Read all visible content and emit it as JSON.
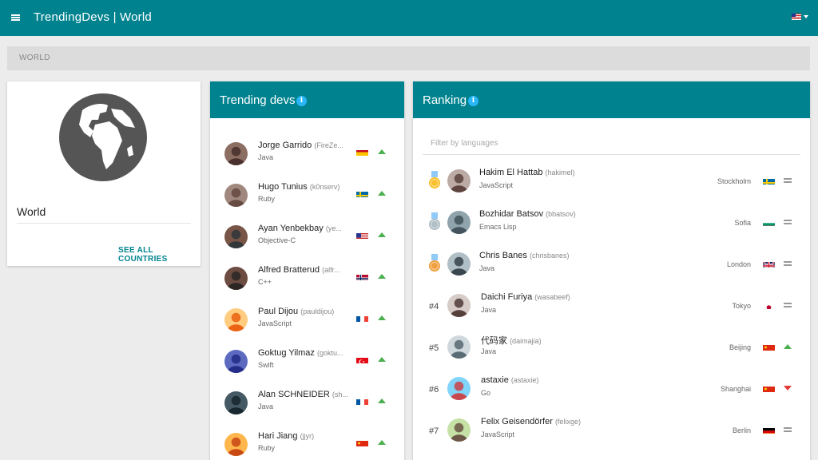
{
  "app": {
    "title": "TrendingDevs | World",
    "menu_icon": "hamburger-menu-icon",
    "language_flag": "us"
  },
  "breadcrumb": {
    "label": "WORLD"
  },
  "world_card": {
    "name": "World",
    "see_all_label": "SEE ALL COUNTRIES",
    "icon": "globe-icon"
  },
  "trending": {
    "title": "Trending devs",
    "items": [
      {
        "name": "Jorge Garrido",
        "handle": "(FireZe...",
        "language": "Java",
        "flag": "es",
        "trend": "up"
      },
      {
        "name": "Hugo Tunius",
        "handle": "(k0nserv)",
        "language": "Ruby",
        "flag": "se",
        "trend": "up"
      },
      {
        "name": "Ayan Yenbekbay",
        "handle": "(ye...",
        "language": "Objective-C",
        "flag": "us",
        "trend": "up"
      },
      {
        "name": "Alfred Bratterud",
        "handle": "(alfr...",
        "language": "C++",
        "flag": "no",
        "trend": "up"
      },
      {
        "name": "Paul Dijou",
        "handle": "(pauldijou)",
        "language": "JavaScript",
        "flag": "fr",
        "trend": "up"
      },
      {
        "name": "Goktug Yilmaz",
        "handle": "(goktu...",
        "language": "Swift",
        "flag": "tr",
        "trend": "up"
      },
      {
        "name": "Alan SCHNEIDER",
        "handle": "(sh...",
        "language": "Java",
        "flag": "fr",
        "trend": "up"
      },
      {
        "name": "Hari Jiang",
        "handle": "(jjyr)",
        "language": "Ruby",
        "flag": "cn",
        "trend": "up"
      }
    ]
  },
  "ranking": {
    "title": "Ranking",
    "filter_placeholder": "Filter by languages",
    "items": [
      {
        "rank": "",
        "medal": "gold",
        "name": "Hakim El Hattab",
        "handle": "(hakimel)",
        "language": "JavaScript",
        "city": "Stockholm",
        "flag": "se",
        "trend": "same"
      },
      {
        "rank": "",
        "medal": "silver",
        "name": "Bozhidar Batsov",
        "handle": "(bbatsov)",
        "language": "Emacs Lisp",
        "city": "Sofia",
        "flag": "bg",
        "trend": "same"
      },
      {
        "rank": "",
        "medal": "bronze",
        "name": "Chris Banes",
        "handle": "(chrisbanes)",
        "language": "Java",
        "city": "London",
        "flag": "gb",
        "trend": "same"
      },
      {
        "rank": "#4",
        "medal": "",
        "name": "Daichi Furiya",
        "handle": "(wasabeef)",
        "language": "Java",
        "city": "Tokyo",
        "flag": "jp",
        "trend": "same"
      },
      {
        "rank": "#5",
        "medal": "",
        "name": "代码家",
        "handle": "(daimajia)",
        "language": "Java",
        "city": "Beijing",
        "flag": "cn",
        "trend": "up"
      },
      {
        "rank": "#6",
        "medal": "",
        "name": "astaxie",
        "handle": "(astaxie)",
        "language": "Go",
        "city": "Shanghai",
        "flag": "cn",
        "trend": "down"
      },
      {
        "rank": "#7",
        "medal": "",
        "name": "Felix Geisendörfer",
        "handle": "(felixge)",
        "language": "JavaScript",
        "city": "Berlin",
        "flag": "de",
        "trend": "same"
      }
    ]
  },
  "colors": {
    "primary": "#00838f",
    "info": "#29b6f6",
    "trend_up": "#4caf50",
    "trend_down": "#e53935",
    "gold": "#fbc02d",
    "silver": "#b0bec5",
    "bronze": "#f0a040"
  }
}
